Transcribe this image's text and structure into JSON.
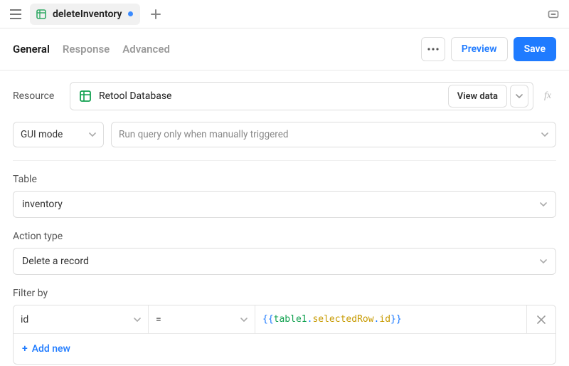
{
  "titlebar": {
    "query_name": "deleteInventory"
  },
  "tabs": {
    "general": "General",
    "response": "Response",
    "advanced": "Advanced"
  },
  "actions": {
    "preview": "Preview",
    "save": "Save"
  },
  "resource": {
    "label": "Resource",
    "name": "Retool Database",
    "view_data": "View data",
    "fx": "fx"
  },
  "mode": {
    "gui_mode": "GUI mode",
    "trigger": "Run query only when manually triggered"
  },
  "table_section": {
    "label": "Table",
    "value": "inventory"
  },
  "action_type": {
    "label": "Action type",
    "value": "Delete a record"
  },
  "filter": {
    "label": "Filter by",
    "column": "id",
    "operator": "=",
    "expr_open": "{{",
    "expr_obj": "table1",
    "expr_dot1": ".",
    "expr_prop1": "selectedRow",
    "expr_dot2": ".",
    "expr_prop2": "id",
    "expr_close": "}}",
    "add_new": "Add new"
  }
}
